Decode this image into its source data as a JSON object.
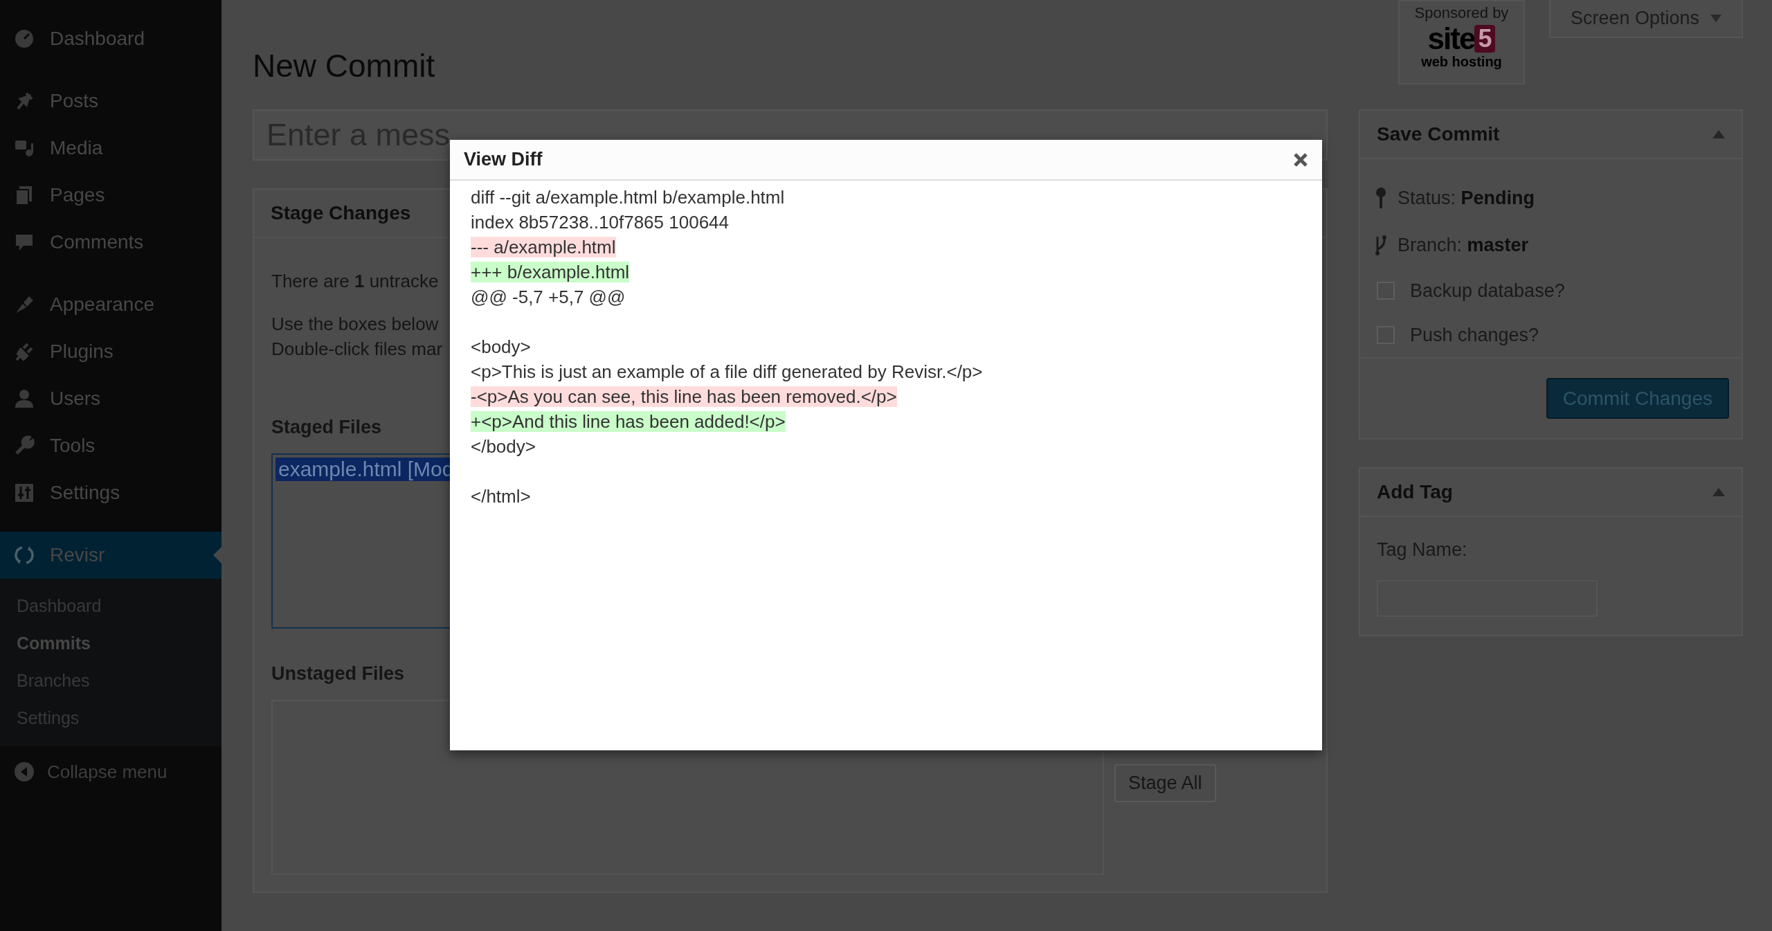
{
  "sidebar": {
    "menu_groups": [
      [
        {
          "label": "Dashboard",
          "selected": false
        }
      ],
      [
        {
          "label": "Posts",
          "selected": false
        },
        {
          "label": "Media",
          "selected": false
        },
        {
          "label": "Pages",
          "selected": false
        },
        {
          "label": "Comments",
          "selected": false
        }
      ],
      [
        {
          "label": "Appearance",
          "selected": false
        },
        {
          "label": "Plugins",
          "selected": false
        },
        {
          "label": "Users",
          "selected": false
        },
        {
          "label": "Tools",
          "selected": false
        },
        {
          "label": "Settings",
          "selected": false
        }
      ],
      [
        {
          "label": "Revisr",
          "selected": true,
          "children": [
            {
              "label": "Dashboard",
              "selected": false
            },
            {
              "label": "Commits",
              "selected": true
            },
            {
              "label": "Branches",
              "selected": false
            },
            {
              "label": "Settings",
              "selected": false
            }
          ]
        }
      ]
    ],
    "collapse": "Collapse menu"
  },
  "sponsor": {
    "caption": "Sponsored by",
    "logo_word": "site",
    "logo_digit": "5",
    "logo_tagline": "web hosting"
  },
  "screen_options": "Screen Options",
  "page_title": "New Commit",
  "message_field": {
    "placeholder": "Enter a mess"
  },
  "stage_changes": {
    "title": "Stage Changes",
    "untracked_note": "There are **1** untracke",
    "instructions": [
      "Use the boxes below",
      "Double-click files mar"
    ],
    "staged": {
      "title": "Staged Files",
      "files": [
        {
          "label": "example.html [Mod",
          "selected": true
        }
      ]
    },
    "unstaged": {
      "title": "Unstaged Files"
    },
    "stage_all": "Stage All"
  },
  "save_commit": {
    "title": "Save Commit",
    "expanded": true,
    "status_label": "Status:",
    "status": "Pending",
    "branch_label": "Branch:",
    "branch": "master",
    "options": [
      {
        "label": "Backup database?",
        "checked": false
      },
      {
        "label": "Push changes?",
        "checked": false
      }
    ],
    "button": "Commit Changes"
  },
  "add_tag": {
    "title": "Add Tag",
    "expanded": true,
    "tag_name_label": "Tag Name:"
  },
  "modal": {
    "title": "View Diff",
    "lines": [
      {
        "kind": "context",
        "text": "diff --git a/example.html b/example.html"
      },
      {
        "kind": "context",
        "text": "index 8b57238..10f7865 100644"
      },
      {
        "kind": "removed",
        "text": "--- a/example.html"
      },
      {
        "kind": "added",
        "text": "+++ b/example.html"
      },
      {
        "kind": "context",
        "text": "@@ -5,7 +5,7 @@"
      },
      {
        "kind": "blank"
      },
      {
        "kind": "context",
        "text": "<body>"
      },
      {
        "kind": "context",
        "text": "<p>This is just an example of a file diff generated by Revisr.</p>"
      },
      {
        "kind": "removed",
        "text": "-<p>As you can see, this line has been removed.</p>"
      },
      {
        "kind": "added",
        "text": "+<p>And this line has been added!</p>"
      },
      {
        "kind": "context",
        "text": "</body>"
      },
      {
        "kind": "blank"
      },
      {
        "kind": "context",
        "text": "</html>"
      }
    ]
  }
}
